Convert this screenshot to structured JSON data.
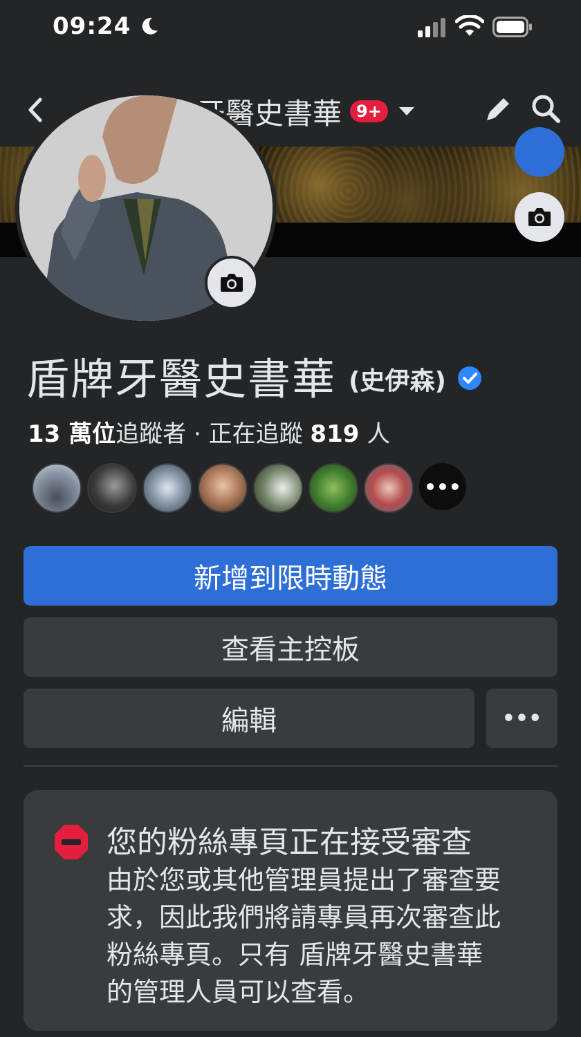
{
  "status_bar": {
    "time": "09:24",
    "icons": [
      "moon-icon",
      "cellular-signal-icon",
      "wifi-icon",
      "battery-icon"
    ]
  },
  "nav": {
    "title": "盾牌牙醫史書華",
    "badge": "9+",
    "icons": [
      "back-chevron-icon",
      "dropdown-caret-icon",
      "pencil-edit-icon",
      "search-icon"
    ]
  },
  "profile": {
    "name": "盾牌牙醫史書華",
    "alt_name": "(史伊森)",
    "verified": true
  },
  "stats": {
    "followers_count": "13 萬位",
    "followers_label": "追蹤者",
    "separator": " · ",
    "following_prefix": "正在追蹤 ",
    "following_count": "819",
    "following_suffix": " 人"
  },
  "followers_preview": {
    "more_label": "•••"
  },
  "buttons": {
    "add_to_story": "新增到限時動態",
    "view_dashboard": "查看主控板",
    "edit": "編輯",
    "more": "•••"
  },
  "review_notice": {
    "title": "您的粉絲專頁正在接受審查",
    "body": "由於您或其他管理員提出了審查要求，因此我們將請專員再次審查此粉絲專頁。只有 盾牌牙醫史書華 的管理人員可以查看。"
  },
  "colors": {
    "background": "#242526",
    "primary_button": "#2d6fd6",
    "secondary_button": "#3a3b3c",
    "badge": "#e41e3f",
    "verified": "#2d88ff",
    "stop_icon": "#e41e3f"
  }
}
